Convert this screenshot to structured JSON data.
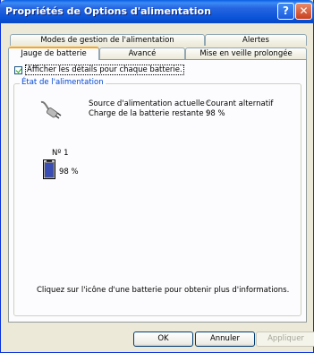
{
  "window": {
    "title": "Propriétés de Options d'alimentation",
    "help_glyph": "?",
    "close_glyph": "✕"
  },
  "tabs_back": [
    {
      "label": "Modes de gestion de l'alimentation"
    },
    {
      "label": "Alertes"
    }
  ],
  "tabs_front": [
    {
      "label": "Jauge de batterie",
      "active": true
    },
    {
      "label": "Avancé"
    },
    {
      "label": "Mise en veille prolongée"
    }
  ],
  "checkbox": {
    "label": "Afficher les détails pour chaque batterie.",
    "checked": true
  },
  "group": {
    "title": "État de l'alimentation",
    "source_label": "Source d'alimentation actuelle :",
    "source_value": "Courant alternatif",
    "charge_label": "Charge de la batterie restante :",
    "charge_value": "98 %"
  },
  "battery": {
    "number": "Nº 1",
    "percent": "98 %",
    "level": 0.98
  },
  "help_text": "Cliquez sur l'icône d'une batterie pour obtenir plus d'informations.",
  "buttons": {
    "ok": "OK",
    "cancel": "Annuler",
    "apply": "Appliquer"
  },
  "colors": {
    "accent_tab": "#f5a623",
    "group_title": "#0046d5",
    "titlebar": "#0b54d9"
  }
}
